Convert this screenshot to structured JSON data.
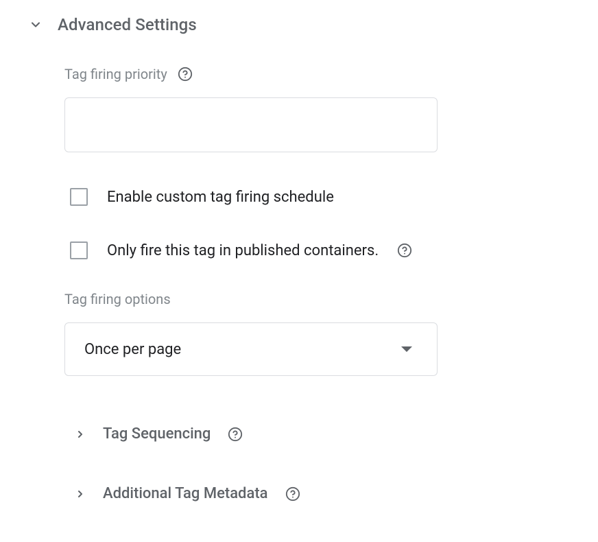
{
  "section": {
    "title": "Advanced Settings"
  },
  "priority": {
    "label": "Tag firing priority",
    "value": ""
  },
  "schedule": {
    "label": "Enable custom tag firing schedule",
    "checked": false
  },
  "publishedOnly": {
    "label": "Only fire this tag in published containers.",
    "checked": false
  },
  "firingOptions": {
    "label": "Tag firing options",
    "selected": "Once per page"
  },
  "subsections": {
    "sequencing": "Tag Sequencing",
    "metadata": "Additional Tag Metadata"
  }
}
